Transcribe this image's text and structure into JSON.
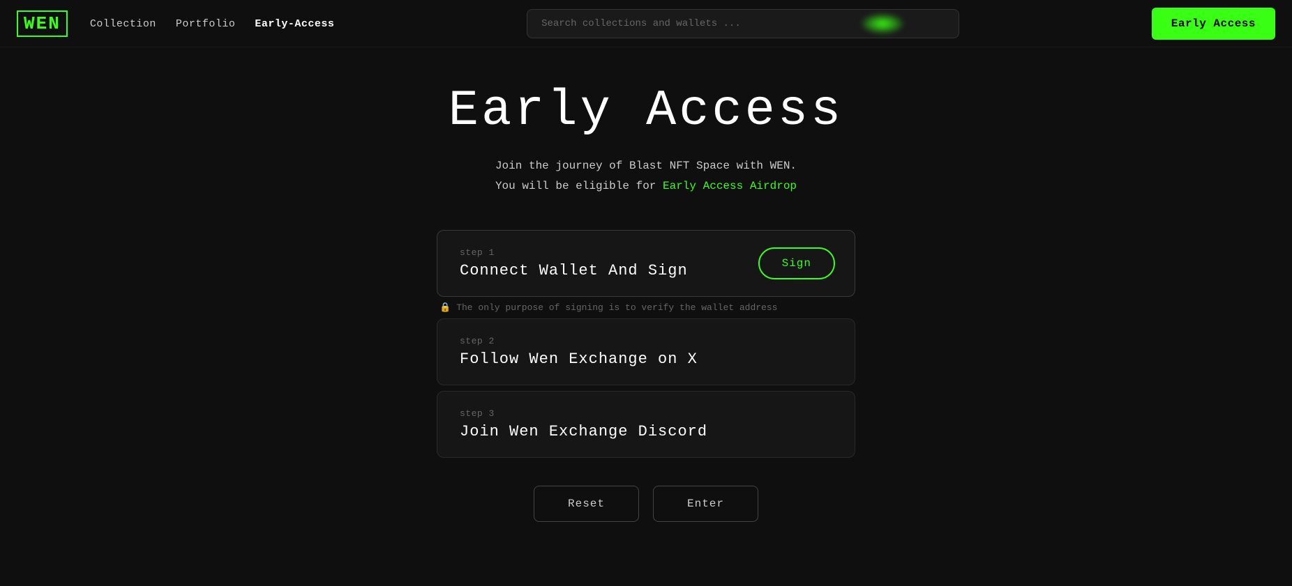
{
  "navbar": {
    "logo": "WEN",
    "nav_items": [
      {
        "label": "Collection",
        "active": false
      },
      {
        "label": "Portfolio",
        "active": false
      },
      {
        "label": "Early-Access",
        "active": true
      }
    ],
    "search_placeholder": "Search collections and wallets ...",
    "cta_button": "Early Access"
  },
  "hero": {
    "title": "Early Access",
    "subtitle_line1": "Join the journey of Blast NFT Space with WEN.",
    "subtitle_line2": "You will be eligible for ",
    "subtitle_highlight": "Early Access Airdrop"
  },
  "steps": [
    {
      "step_label": "step 1",
      "step_title": "Connect Wallet And Sign",
      "has_action": true,
      "action_label": "Sign",
      "note_emoji": "🔒",
      "note_text": "The only purpose of signing is to verify the wallet address"
    },
    {
      "step_label": "step 2",
      "step_title": "Follow Wen Exchange on X",
      "has_action": false
    },
    {
      "step_label": "step 3",
      "step_title": "Join Wen Exchange Discord",
      "has_action": false
    }
  ],
  "buttons": {
    "reset": "Reset",
    "enter": "Enter"
  },
  "colors": {
    "accent": "#39ff14",
    "bg": "#0f0f0f",
    "card_bg": "#161616",
    "border": "#2a2a2a",
    "text_muted": "#666666"
  }
}
